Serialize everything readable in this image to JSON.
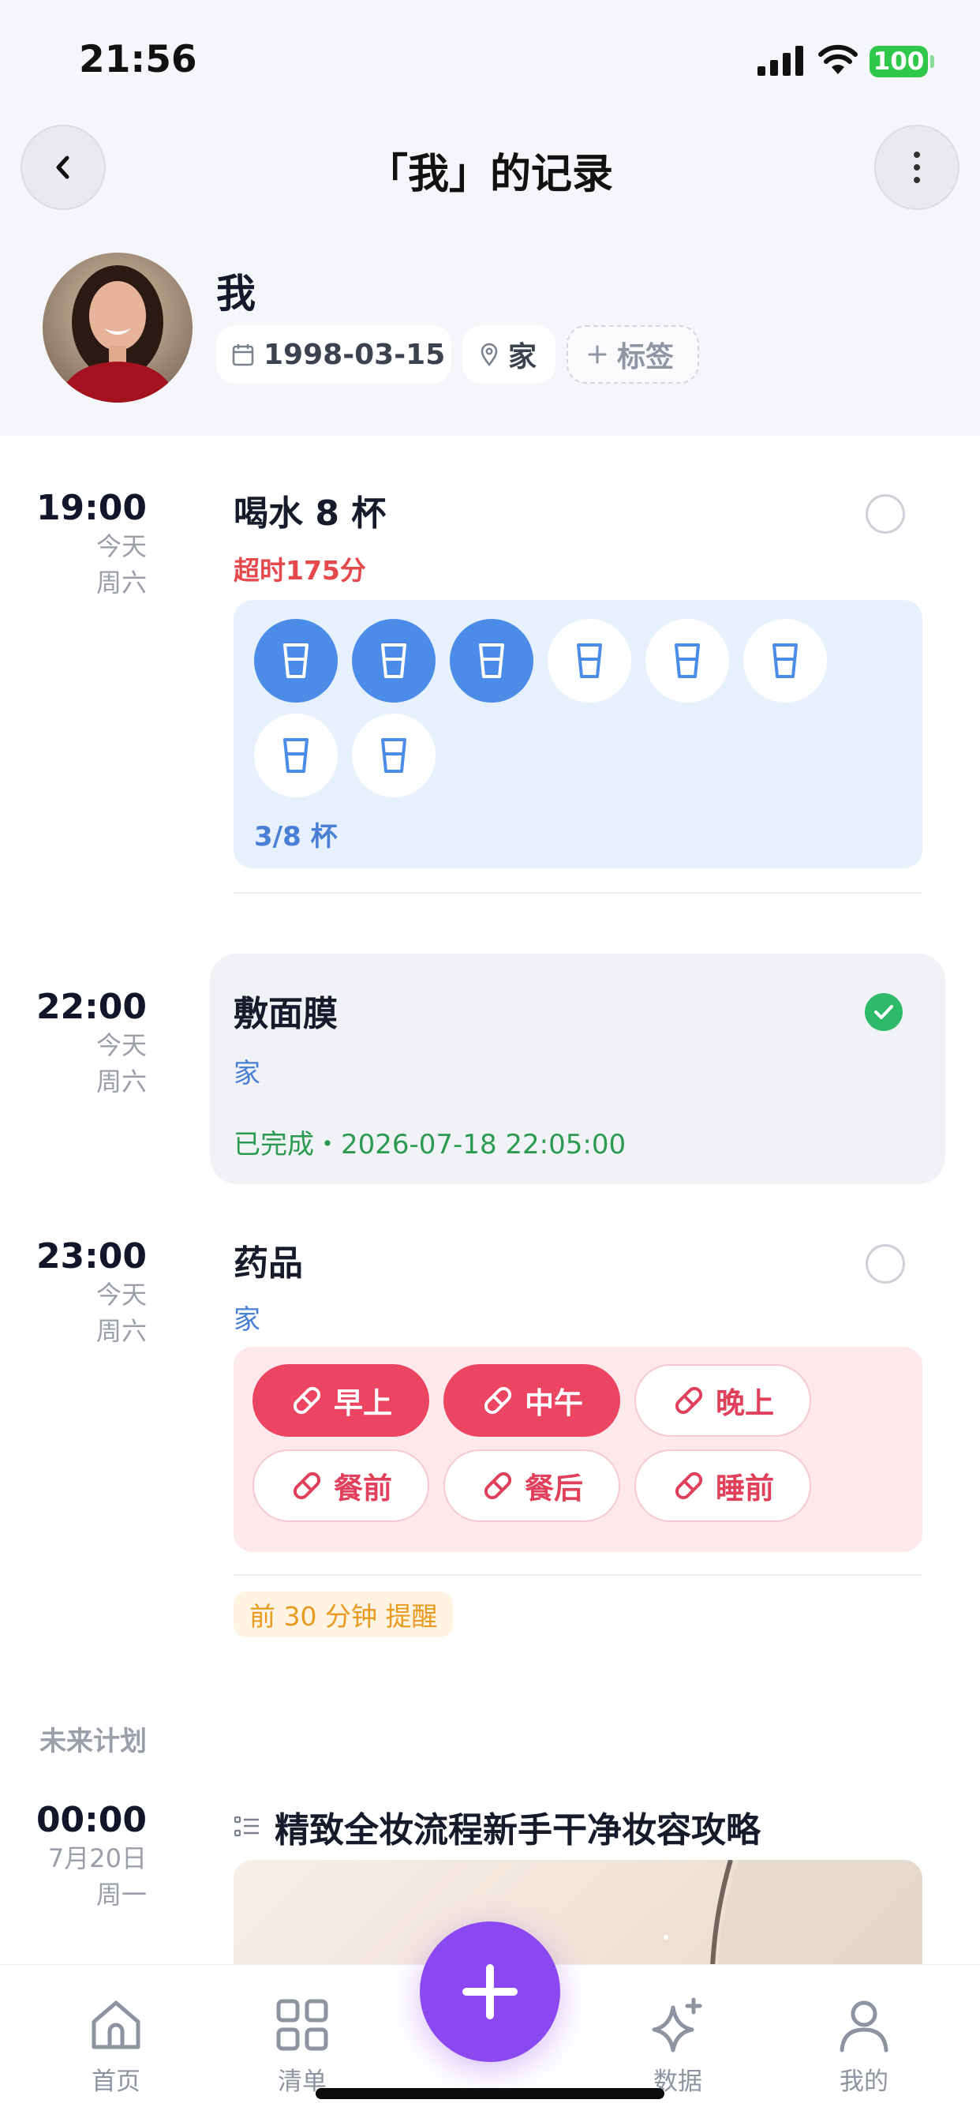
{
  "status_bar": {
    "time": "21:56",
    "battery": "100"
  },
  "header": {
    "title": "「我」的记录"
  },
  "profile": {
    "name": "我",
    "birthday": "1998-03-15",
    "location": "家",
    "add_tag": "标签"
  },
  "tasks": [
    {
      "time": "19:00",
      "day": "今天",
      "weekday": "周六",
      "title": "喝水 8 杯",
      "overdue": "超时175分",
      "water": {
        "total": 8,
        "filled": 3,
        "count_label": "3/8 杯"
      }
    },
    {
      "time": "22:00",
      "day": "今天",
      "weekday": "周六",
      "title": "敷面膜",
      "location": "家",
      "completed_text": "已完成・2026-07-18 22:05:00"
    },
    {
      "time": "23:00",
      "day": "今天",
      "weekday": "周六",
      "title": "药品",
      "location": "家",
      "pills": [
        {
          "label": "早上",
          "active": true
        },
        {
          "label": "中午",
          "active": true
        },
        {
          "label": "晚上",
          "active": false
        },
        {
          "label": "餐前",
          "active": false
        },
        {
          "label": "餐后",
          "active": false
        },
        {
          "label": "睡前",
          "active": false
        }
      ],
      "reminder": "前 30 分钟 提醒"
    }
  ],
  "future": {
    "section_label": "未来计划",
    "time": "00:00",
    "day": "7月20日",
    "weekday": "周一",
    "title": "精致全妆流程新手干净妆容攻略"
  },
  "tab_bar": {
    "items": [
      {
        "label": "首页",
        "icon": "home-icon"
      },
      {
        "label": "清单",
        "icon": "grid-icon"
      },
      {
        "label": "数据",
        "icon": "sparkle-icon"
      },
      {
        "label": "我的",
        "icon": "user-icon"
      }
    ],
    "fab_icon": "plus-icon"
  },
  "colors": {
    "accent_purple": "#8b48f0",
    "water_blue": "#4a8ce8",
    "pill_red": "#ec4561",
    "done_green": "#2a9b51",
    "overdue_red": "#e5484d",
    "remind_orange": "#e79a1f"
  }
}
